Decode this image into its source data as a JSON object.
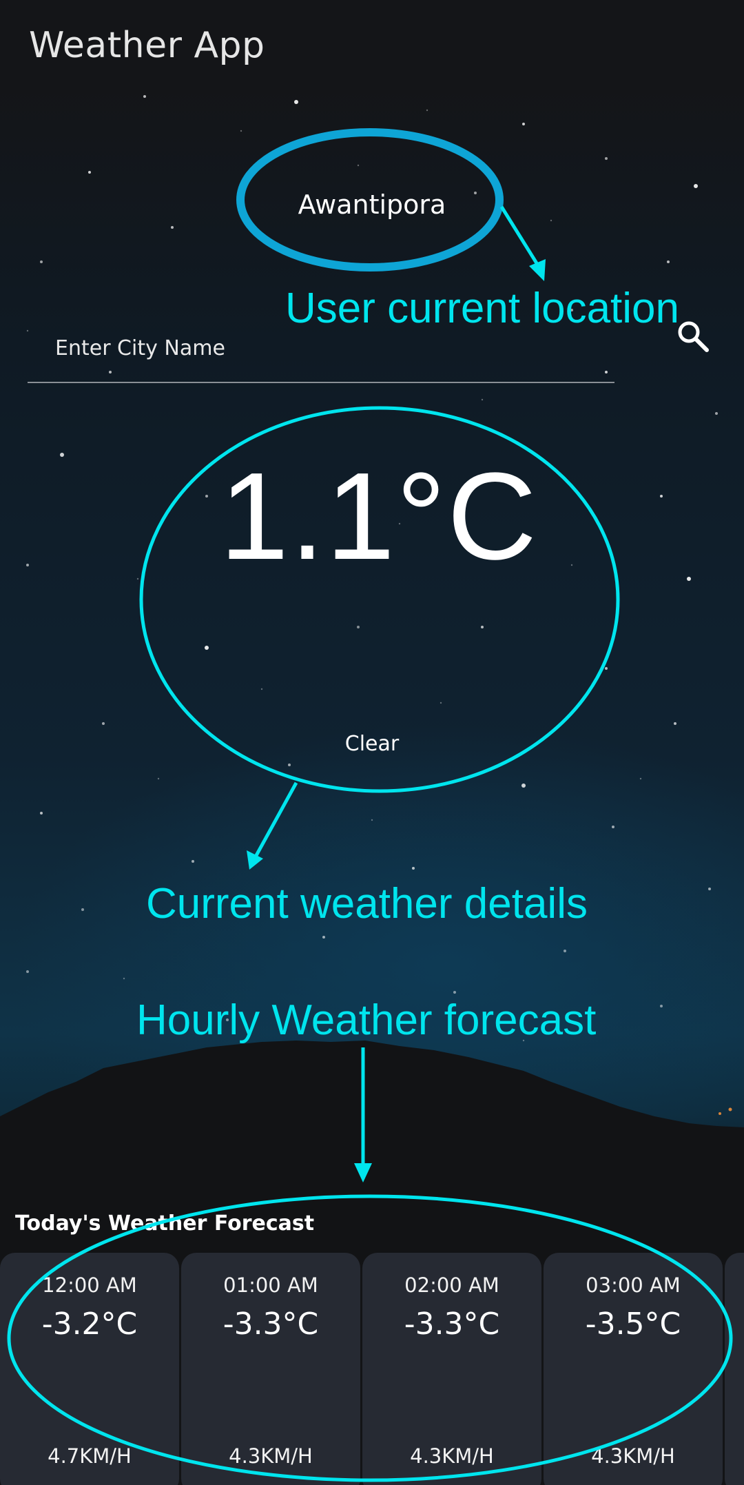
{
  "app": {
    "title": "Weather App"
  },
  "location": {
    "name": "Awantipora"
  },
  "search": {
    "placeholder": "Enter City Name"
  },
  "current": {
    "temperature": "1.1°C",
    "condition": "Clear",
    "icon": "moon-icon"
  },
  "annotations": {
    "location": "User current location",
    "current": "Current weather details",
    "hourly": "Hourly Weather forecast",
    "color": "#00e5ee",
    "circle_color": "#0ea5d6"
  },
  "forecast": {
    "title": "Today's Weather Forecast",
    "items": [
      {
        "time": "12:00 AM",
        "temp": "-3.2°C",
        "icon": "moon-icon",
        "wind": "4.7KM/H"
      },
      {
        "time": "01:00 AM",
        "temp": "-3.3°C",
        "icon": "moon-icon",
        "wind": "4.3KM/H"
      },
      {
        "time": "02:00 AM",
        "temp": "-3.3°C",
        "icon": "moon-icon",
        "wind": "4.3KM/H"
      },
      {
        "time": "03:00 AM",
        "temp": "-3.5°C",
        "icon": "moon-icon",
        "wind": "4.3KM/H"
      }
    ]
  }
}
